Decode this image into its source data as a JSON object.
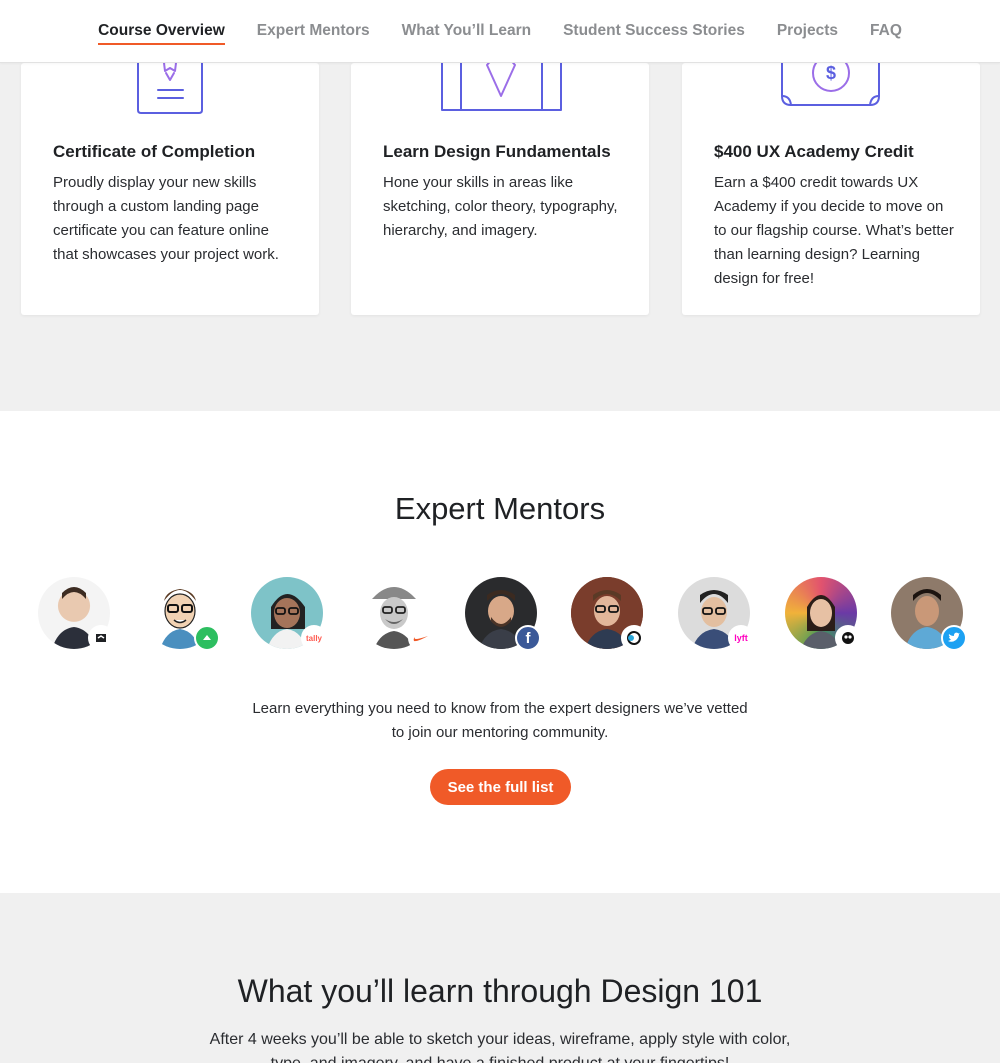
{
  "nav": {
    "items": [
      {
        "label": "Course Overview",
        "active": true
      },
      {
        "label": "Expert Mentors",
        "active": false
      },
      {
        "label": "What You’ll Learn",
        "active": false
      },
      {
        "label": "Student Success Stories",
        "active": false
      },
      {
        "label": "Projects",
        "active": false
      },
      {
        "label": "FAQ",
        "active": false
      }
    ]
  },
  "features": {
    "cards": [
      {
        "title": "Certificate of Completion",
        "body": "Proudly display your new skills through a custom landing page certificate you can feature online that showcases your project work.",
        "icon": "certificate-icon"
      },
      {
        "title": "Learn Design Fundamentals",
        "body": "Hone your skills in areas like sketching, color theory, typography, hierarchy, and imagery.",
        "icon": "design-board-icon"
      },
      {
        "title": "$400 UX Academy Credit",
        "body": "Earn a $400 credit towards UX Academy if you decide to move on to our flagship course. What’s better than learning design? Learning design for free!",
        "icon": "dollar-bill-icon",
        "icon_symbol": "$"
      }
    ]
  },
  "mentors": {
    "heading": "Expert Mentors",
    "avatars": [
      {
        "badge_icon": "company-logo-icon"
      },
      {
        "badge_icon": "evernote-icon"
      },
      {
        "badge_icon": "tally-icon",
        "badge_text": "tally"
      },
      {
        "badge_icon": "nike-icon"
      },
      {
        "badge_icon": "facebook-icon",
        "badge_text": "f"
      },
      {
        "badge_icon": "discovery-icon"
      },
      {
        "badge_icon": "lyft-icon",
        "badge_text": "lyft"
      },
      {
        "badge_icon": "hootsuite-icon"
      },
      {
        "badge_icon": "twitter-icon"
      }
    ],
    "description_line1": "Learn everything you need to know from the expert designers we’ve vetted",
    "description_line2": "to join our mentoring community.",
    "button_label": "See the full list"
  },
  "learn": {
    "heading": "What you’ll learn through Design 101",
    "lead": "After 4 weeks you’ll be able to sketch your ideas, wireframe, apply style with color, type, and imagery, and have a finished product at your fingertips!"
  },
  "colors": {
    "accent": "#f05a28",
    "icon_stroke": "#5b5fe0",
    "nav_inactive": "#8b8d90",
    "text": "#1f2124",
    "section_gray": "#f0f0f0",
    "facebook": "#3b5998",
    "twitter": "#1da1f2",
    "lyft": "#ff00bf"
  }
}
